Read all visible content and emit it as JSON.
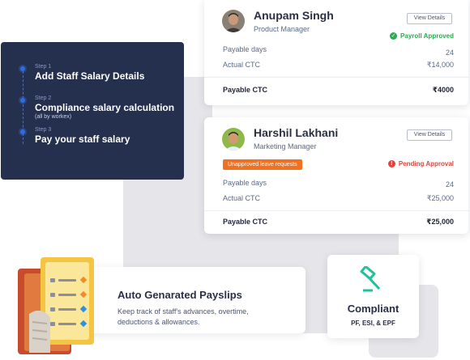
{
  "steps": [
    {
      "num": "Step 1",
      "title": "Add Staff Salary Details",
      "sub": ""
    },
    {
      "num": "Step 2",
      "title": "Compliance salary calculation",
      "sub": "(all by workex)"
    },
    {
      "num": "Step 3",
      "title": "Pay your staff salary",
      "sub": ""
    }
  ],
  "cards": [
    {
      "name": "Anupam Singh",
      "role": "Product Manager",
      "details_label": "View Details",
      "status": "Payroll Approved",
      "status_color": "#24b04b",
      "payable_days_label": "Payable days",
      "payable_days": "24",
      "actual_ctc_label": "Actual CTC",
      "actual_ctc": "₹14,000",
      "payable_ctc_label": "Payable CTC",
      "payable_ctc": "₹4000"
    },
    {
      "name": "Harshil Lakhani",
      "role": "Marketing Manager",
      "details_label": "View Details",
      "badge": "Unapproved leave requests",
      "badge_color": "#f37021",
      "status": "Pending Approval",
      "status_color": "#e0443c",
      "payable_days_label": "Payable days",
      "payable_days": "24",
      "actual_ctc_label": "Actual CTC",
      "actual_ctc": "₹25,000",
      "payable_ctc_label": "Payable CTC",
      "payable_ctc": "₹25,000"
    }
  ],
  "payslips": {
    "title": "Auto Genarated Payslips",
    "desc": "Keep track of staff's advances, overtime, deductions & allowances.",
    "icon": "document-list-icon"
  },
  "compliant": {
    "title": "Compliant",
    "sub": "PF, ESI, & EPF",
    "icon": "gavel-icon",
    "accent": "#1ec39a"
  },
  "colors": {
    "panel": "#25304f",
    "accent_blue": "#2f6dde"
  }
}
